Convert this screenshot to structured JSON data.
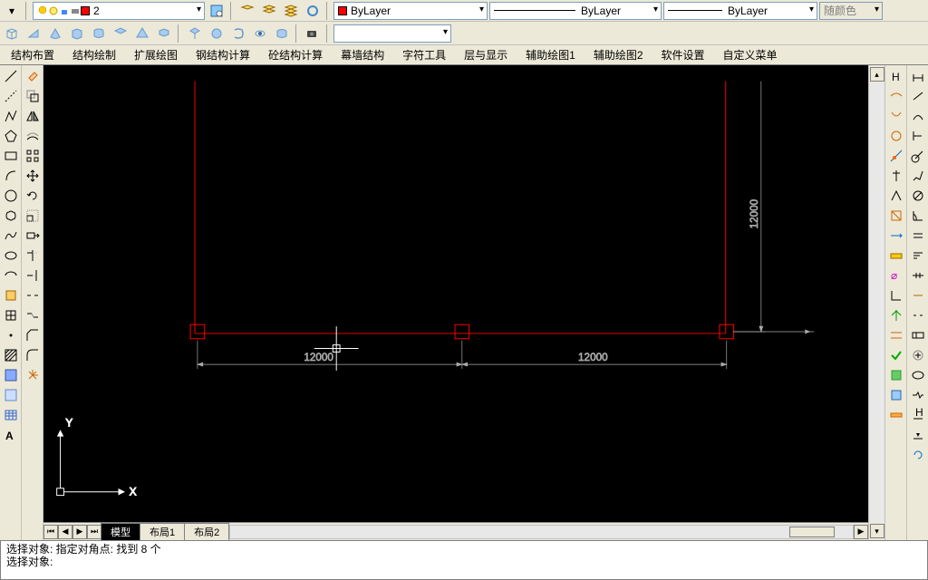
{
  "toolbars": {
    "layer_dropdown": "2",
    "bylayer_color": "ByLayer",
    "bylayer_ltype": "ByLayer",
    "bylayer_lweight": "ByLayer",
    "color_disabled": "随颜色"
  },
  "menus": [
    "结构布置",
    "结构绘制",
    "扩展绘图",
    "钢结构计算",
    "砼结构计算",
    "幕墙结构",
    "字符工具",
    "层与显示",
    "辅助绘图1",
    "辅助绘图2",
    "软件设置",
    "自定义菜单"
  ],
  "drawing": {
    "dim_h1": "12000",
    "dim_h2": "12000",
    "dim_v": "12000",
    "ucs_x": "X",
    "ucs_y": "Y"
  },
  "layout_tabs": {
    "model": "模型",
    "layout1": "布局1",
    "layout2": "布局2"
  },
  "command": {
    "line1": "选择对象: 指定对角点: 找到 8 个",
    "line2": "选择对象:"
  }
}
